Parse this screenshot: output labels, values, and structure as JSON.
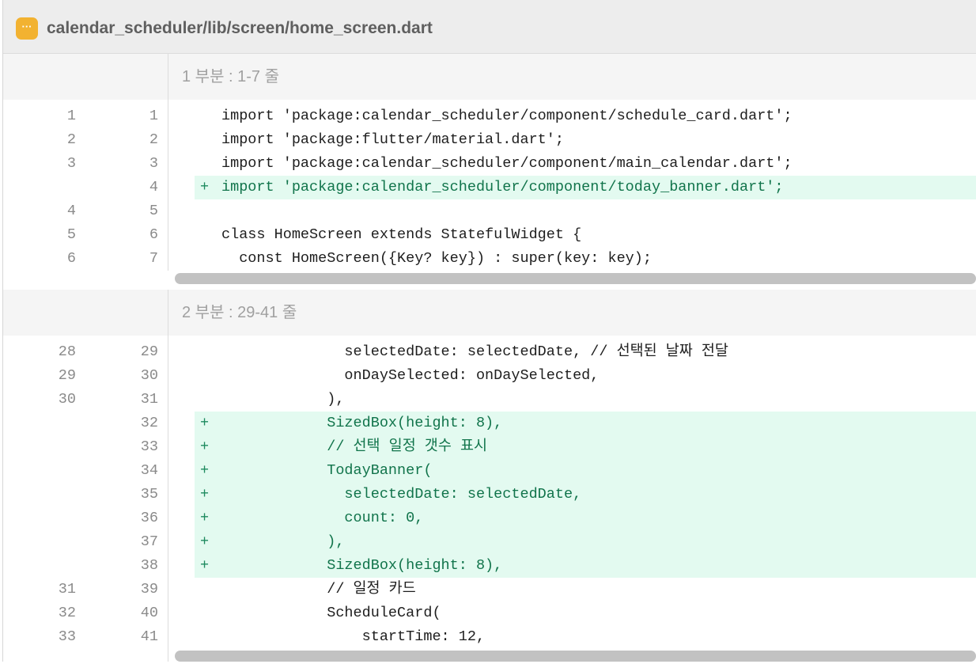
{
  "file": {
    "icon": "ellipsis-file-icon",
    "icon_glyph": "···",
    "path": "calendar_scheduler/lib/screen/home_screen.dart"
  },
  "hunks": [
    {
      "title": "1 부분 : 1-7 줄",
      "lines": [
        {
          "old": "1",
          "new": "1",
          "type": "context",
          "code": "import 'package:calendar_scheduler/component/schedule_card.dart';"
        },
        {
          "old": "2",
          "new": "2",
          "type": "context",
          "code": "import 'package:flutter/material.dart';"
        },
        {
          "old": "3",
          "new": "3",
          "type": "context",
          "code": "import 'package:calendar_scheduler/component/main_calendar.dart';"
        },
        {
          "old": "",
          "new": "4",
          "type": "added",
          "code": "import 'package:calendar_scheduler/component/today_banner.dart';"
        },
        {
          "old": "4",
          "new": "5",
          "type": "context",
          "code": ""
        },
        {
          "old": "5",
          "new": "6",
          "type": "context",
          "code": "class HomeScreen extends StatefulWidget {"
        },
        {
          "old": "6",
          "new": "7",
          "type": "context",
          "code": "  const HomeScreen({Key? key}) : super(key: key);"
        }
      ]
    },
    {
      "title": "2 부분 : 29-41 줄",
      "lines": [
        {
          "old": "28",
          "new": "29",
          "type": "context",
          "code": "              selectedDate: selectedDate, // 선택된 날짜 전달"
        },
        {
          "old": "29",
          "new": "30",
          "type": "context",
          "code": "              onDaySelected: onDaySelected,"
        },
        {
          "old": "30",
          "new": "31",
          "type": "context",
          "code": "            ),"
        },
        {
          "old": "",
          "new": "32",
          "type": "added",
          "code": "            SizedBox(height: 8),"
        },
        {
          "old": "",
          "new": "33",
          "type": "added",
          "code": "            // 선택 일정 갯수 표시"
        },
        {
          "old": "",
          "new": "34",
          "type": "added",
          "code": "            TodayBanner("
        },
        {
          "old": "",
          "new": "35",
          "type": "added",
          "code": "              selectedDate: selectedDate,"
        },
        {
          "old": "",
          "new": "36",
          "type": "added",
          "code": "              count: 0,"
        },
        {
          "old": "",
          "new": "37",
          "type": "added",
          "code": "            ),"
        },
        {
          "old": "",
          "new": "38",
          "type": "added",
          "code": "            SizedBox(height: 8),"
        },
        {
          "old": "31",
          "new": "39",
          "type": "context",
          "code": "            // 일정 카드"
        },
        {
          "old": "32",
          "new": "40",
          "type": "context",
          "code": "            ScheduleCard("
        },
        {
          "old": "33",
          "new": "41",
          "type": "context",
          "code": "                startTime: 12,"
        }
      ]
    }
  ],
  "added_marker": "+",
  "colors": {
    "added_background": "#e3faf0",
    "added_text": "#11744b",
    "file_icon": "#f2b231"
  }
}
